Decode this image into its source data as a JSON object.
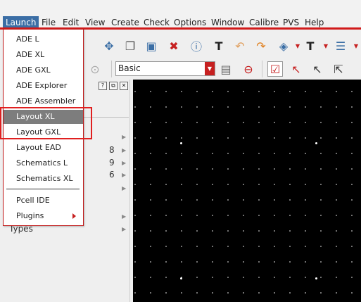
{
  "menubar": {
    "items": [
      "Launch",
      "File",
      "Edit",
      "View",
      "Create",
      "Check",
      "Options",
      "Window",
      "Calibre",
      "PVS",
      "Help"
    ],
    "underline": [
      "L",
      "F",
      "E",
      "V",
      "C",
      "h",
      "O",
      "W",
      "l",
      "P",
      "H"
    ]
  },
  "toolbar": {
    "select_value": "Basic"
  },
  "left_panel": {
    "numbers": [
      "8",
      "9",
      "6"
    ],
    "types_label": "Types"
  },
  "launch_menu": {
    "items": [
      {
        "label": "ADE L"
      },
      {
        "label": "ADE XL"
      },
      {
        "label": "ADE GXL"
      },
      {
        "label": "ADE Explorer"
      },
      {
        "label": "ADE Assembler"
      },
      {
        "label": "Layout XL",
        "highlighted": true
      },
      {
        "label": "Layout GXL"
      },
      {
        "label": "Layout EAD"
      },
      {
        "label": "Schematics L"
      },
      {
        "label": "Schematics XL"
      },
      {
        "label": "Pcell IDE"
      },
      {
        "label": "Plugins",
        "submenu": true
      }
    ]
  },
  "colors": {
    "accent_red": "#d11a1a",
    "menu_active": "#3b6ea5",
    "highlight": "#7d7d7d",
    "canvas": "#000000"
  }
}
